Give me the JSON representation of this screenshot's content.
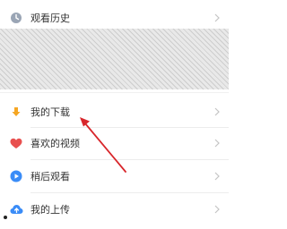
{
  "menu": {
    "items": [
      {
        "label": "观看历史",
        "icon": "clock-icon"
      },
      {
        "label": "我的下载",
        "icon": "download-arrow-icon",
        "icon_color": "#f5a623"
      },
      {
        "label": "喜欢的视频",
        "icon": "heart-icon",
        "icon_color": "#e8504f"
      },
      {
        "label": "稍后观看",
        "icon": "play-circle-icon",
        "icon_color": "#3a8cf7"
      },
      {
        "label": "我的上传",
        "icon": "cloud-upload-icon",
        "icon_color": "#3a8cf7"
      }
    ]
  },
  "annotation": {
    "arrow_color": "#d8262b",
    "points_to": "我的下载"
  }
}
